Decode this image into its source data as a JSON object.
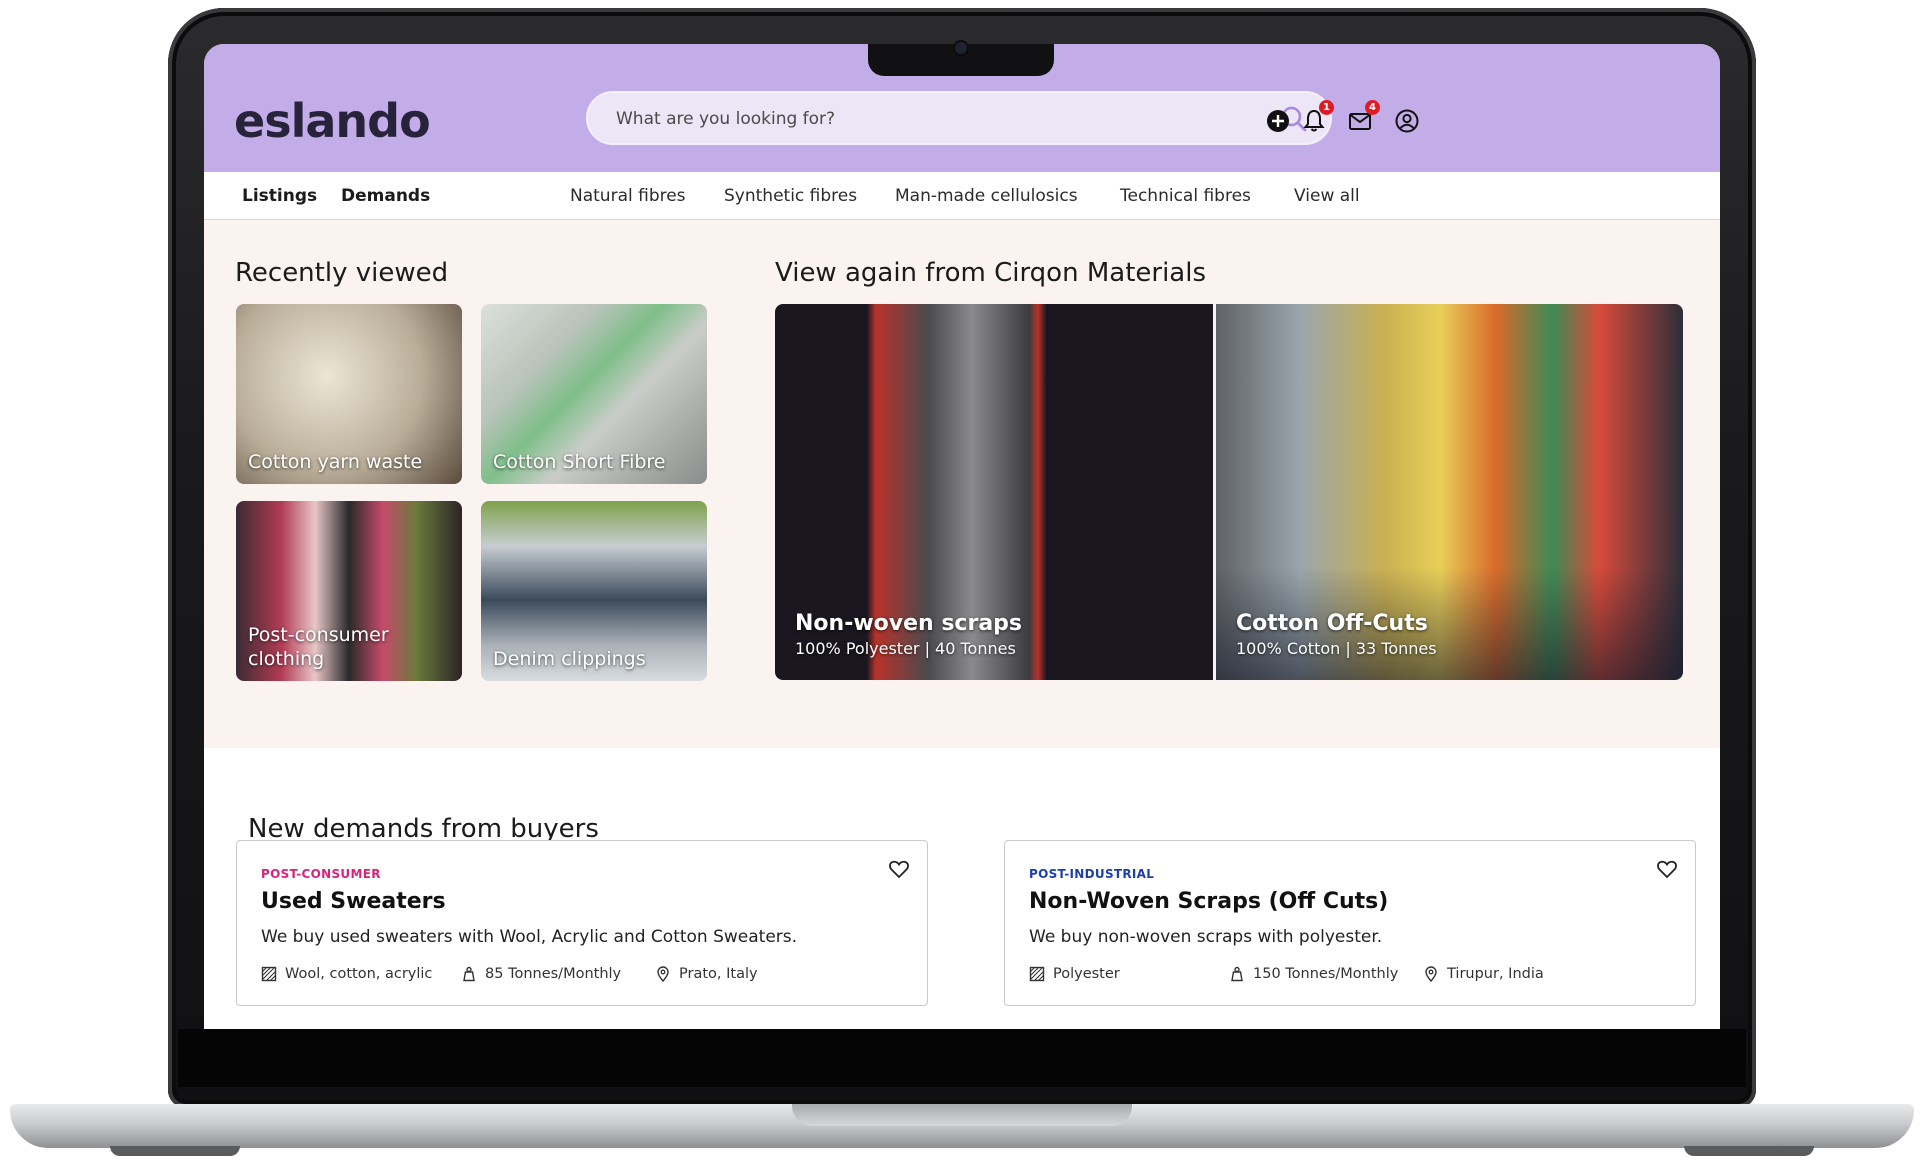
{
  "brand": {
    "logo_text": "eslando"
  },
  "search": {
    "placeholder": "What are you looking for?"
  },
  "header_icons": {
    "notifications_count": "1",
    "messages_count": "4"
  },
  "nav": {
    "tabs": [
      {
        "label": "Listings"
      },
      {
        "label": "Demands"
      }
    ],
    "categories": [
      {
        "label": "Natural fibres"
      },
      {
        "label": "Synthetic fibres"
      },
      {
        "label": "Man-made cellulosics"
      },
      {
        "label": "Technical fibres"
      },
      {
        "label": "View all"
      }
    ]
  },
  "recently_viewed": {
    "title": "Recently viewed",
    "items": [
      {
        "label": "Cotton yarn waste"
      },
      {
        "label": "Cotton Short Fibre"
      },
      {
        "label": "Post-consumer clothing"
      },
      {
        "label": "Denim clippings"
      }
    ]
  },
  "view_again": {
    "title": "View again from Cirqon Materials",
    "items": [
      {
        "name": "Non-woven scraps",
        "meta": "100% Polyester |  40 Tonnes"
      },
      {
        "name": "Cotton Off-Cuts",
        "meta": "100% Cotton  |  33 Tonnes"
      }
    ]
  },
  "demands": {
    "title": "New demands from buyers",
    "cards": [
      {
        "tag": "POST-CONSUMER",
        "tag_color": "#d6247a",
        "title": "Used Sweaters",
        "description": "We buy used sweaters with Wool, Acrylic and Cotton Sweaters.",
        "material": "Wool, cotton, acrylic",
        "quantity": "85 Tonnes/Monthly",
        "location": "Prato, Italy"
      },
      {
        "tag": "POST-INDUSTRIAL",
        "tag_color": "#1d3fa8",
        "title": "Non-Woven Scraps (Off Cuts)",
        "description": "We buy non-woven scraps with polyester.",
        "material": "Polyester",
        "quantity": "150 Tonnes/Monthly",
        "location": "Tirupur, India"
      }
    ]
  }
}
